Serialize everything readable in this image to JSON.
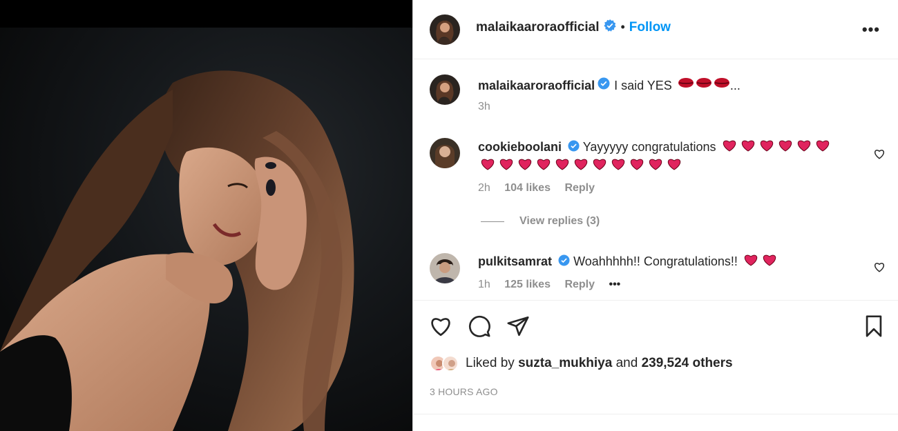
{
  "post": {
    "author": "malaikaaroraofficial",
    "follow_label": "Follow",
    "caption": "I said YES",
    "caption_suffix": "...",
    "caption_time": "3h"
  },
  "comments": [
    {
      "username": "cookieboolani",
      "text": "Yayyyyy congratulations",
      "time": "2h",
      "likes": "104 likes",
      "reply_label": "Reply",
      "view_replies": "View replies (3)"
    },
    {
      "username": "pulkitsamrat",
      "text": "Woahhhhh!! Congratulations!!",
      "time": "1h",
      "likes": "125 likes",
      "reply_label": "Reply",
      "more": "•••"
    }
  ],
  "likes_line": {
    "prefix": "Liked by",
    "user": "suzta_mukhiya",
    "middle": "and",
    "count": "239,524 others"
  },
  "timestamp": "3 HOURS AGO",
  "colors": {
    "accent": "#0095f6",
    "verified": "#3897f0",
    "heart": "#e0245e",
    "muted": "#8e8e8e"
  },
  "icons": [
    "more-icon",
    "verified-icon",
    "heart-icon",
    "comment-icon",
    "share-icon",
    "bookmark-icon"
  ]
}
